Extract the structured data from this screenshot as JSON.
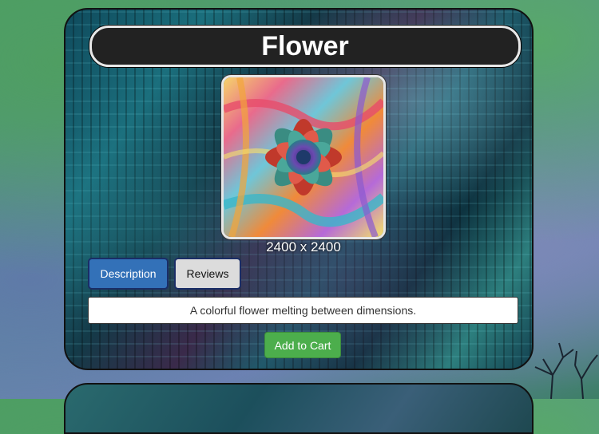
{
  "product": {
    "title": "Flower",
    "dimensions": "2400 x 2400",
    "image_icon": "flower-artwork"
  },
  "tabs": [
    {
      "label": "Description",
      "active": true
    },
    {
      "label": "Reviews",
      "active": false
    }
  ],
  "description": "A colorful flower melting between dimensions.",
  "actions": {
    "add_to_cart": "Add to Cart"
  },
  "colors": {
    "active_tab": "#3371b8",
    "inactive_tab": "#dcdcdc",
    "cart_button": "#4cae4c",
    "title_bar": "#222222"
  }
}
